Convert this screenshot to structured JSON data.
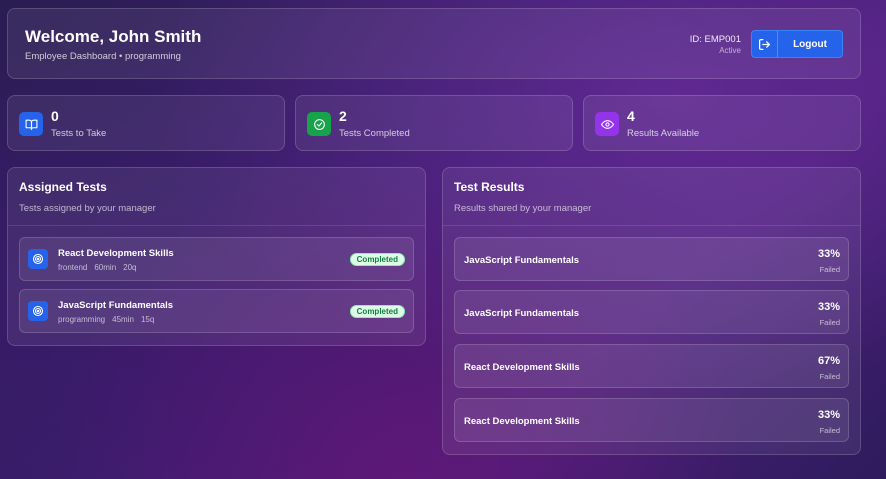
{
  "header": {
    "welcome": "Welcome, John Smith",
    "subtitle": "Employee Dashboard • programming",
    "employee_id": "ID: EMP001",
    "status": "Active",
    "logout_label": "Logout"
  },
  "stats": [
    {
      "value": "0",
      "label": "Tests to Take",
      "icon": "book-open-icon",
      "color": "#2563eb"
    },
    {
      "value": "2",
      "label": "Tests Completed",
      "icon": "check-circle-icon",
      "color": "#16a34a"
    },
    {
      "value": "4",
      "label": "Results Available",
      "icon": "eye-icon",
      "color": "#9333ea"
    }
  ],
  "assigned": {
    "title": "Assigned Tests",
    "subtitle": "Tests assigned by your manager",
    "tests": [
      {
        "name": "React Development Skills",
        "category": "frontend",
        "duration": "60min",
        "questions": "20q",
        "status": "Completed"
      },
      {
        "name": "JavaScript Fundamentals",
        "category": "programming",
        "duration": "45min",
        "questions": "15q",
        "status": "Completed"
      }
    ]
  },
  "results": {
    "title": "Test Results",
    "subtitle": "Results shared by your manager",
    "items": [
      {
        "name": "JavaScript Fundamentals",
        "score": "33%",
        "status": "Failed"
      },
      {
        "name": "JavaScript Fundamentals",
        "score": "33%",
        "status": "Failed"
      },
      {
        "name": "React Development Skills",
        "score": "67%",
        "status": "Failed"
      },
      {
        "name": "React Development Skills",
        "score": "33%",
        "status": "Failed"
      }
    ]
  }
}
